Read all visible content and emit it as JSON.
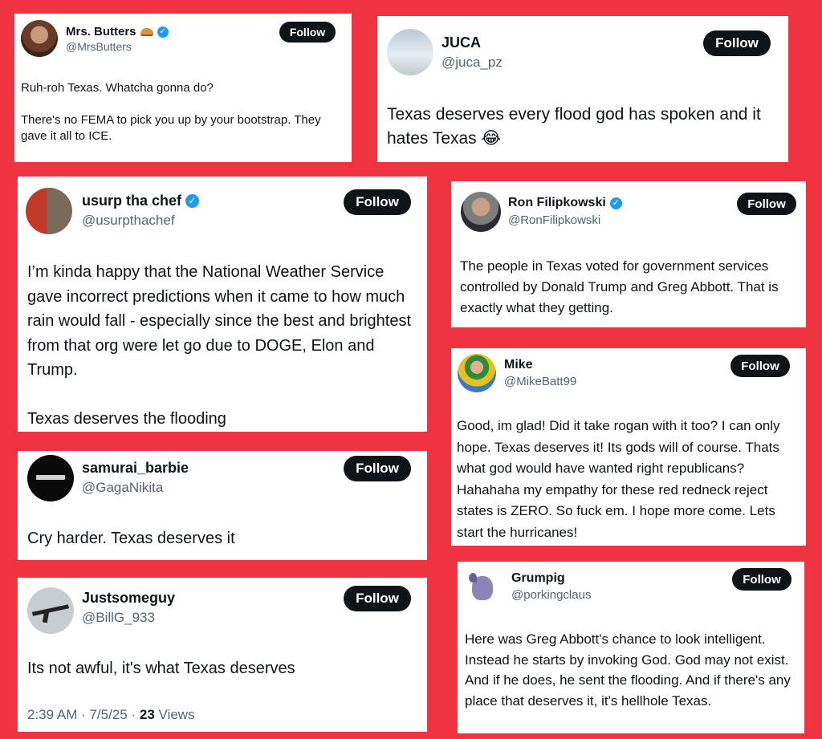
{
  "follow_label": "Follow",
  "tweets": [
    {
      "name": "Mrs. Butters",
      "handle": "@MrsButters",
      "verified": true,
      "emoji": "pie-icon",
      "text": "Ruh-roh Texas. Whatcha gonna do?\n\nThere's no FEMA to pick you up by your bootstrap. They gave it all to ICE."
    },
    {
      "name": "JUCA",
      "handle": "@juca_pz",
      "verified": false,
      "text": "Texas deserves every flood god has spoken and it hates Texas 😂"
    },
    {
      "name": "usurp tha chef",
      "handle": "@usurpthachef",
      "verified": true,
      "text": "I’m kinda happy that the National Weather Service gave incorrect predictions when it came to how much rain would fall - especially since the best and brightest from that org were let go due to DOGE, Elon and Trump.\n\nTexas deserves the flooding"
    },
    {
      "name": "Ron Filipkowski",
      "handle": "@RonFilipkowski",
      "verified": true,
      "text": "The people in Texas voted for government services controlled by Donald Trump and Greg Abbott. That is exactly what they getting."
    },
    {
      "name": "Mike",
      "handle": "@MikeBatt99",
      "verified": false,
      "text": "Good, im glad! Did it take rogan with it too? I can only hope. Texas deserves it! Its gods will of course. Thats what god would have wanted right republicans? Hahahaha my empathy for these red redneck reject states is ZERO. So fuck em. I hope more come. Lets start the hurricanes!"
    },
    {
      "name": "samurai_barbie",
      "handle": "@GagaNikita",
      "verified": false,
      "text": "Cry harder. Texas deserves it"
    },
    {
      "name": "Justsomeguy",
      "handle": "@BillG_933",
      "verified": false,
      "text": "Its not awful, it's what Texas deserves",
      "time": "2:39 AM · 7/5/25 · ",
      "views_count": "23",
      "views_label": " Views"
    },
    {
      "name": "Grumpig",
      "handle": "@porkingclaus",
      "verified": false,
      "text": "Here was Greg Abbott's chance to look intelligent. Instead he starts by invoking God. God may not exist. And if he does, he sent the flooding. And if there's any place that deserves it, it's hellhole Texas."
    }
  ],
  "colors": {
    "background": "#ef3340",
    "follow_button": "#0f1419",
    "verified": "#1d9bf0",
    "handle": "#536471"
  }
}
